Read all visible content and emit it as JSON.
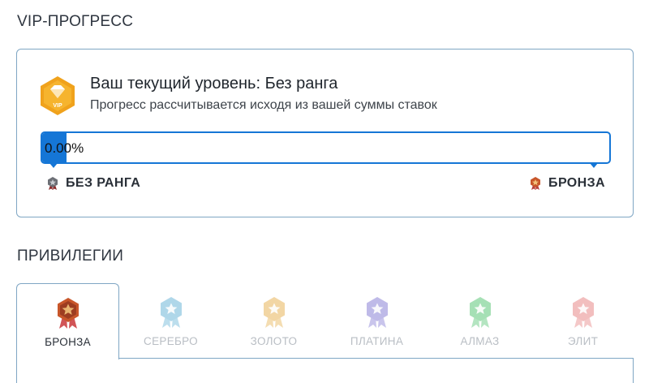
{
  "sections": {
    "vip_title": "VIP-ПРОГРЕСС",
    "privileges_title": "ПРИВИЛЕГИИ"
  },
  "vip": {
    "badge_icon": "vip-diamond-badge-icon",
    "level_title": "Ваш текущий уровень: Без ранга",
    "level_subtitle": "Прогресс рассчитывается исходя из вашей суммы ставок",
    "progress_percent": 0,
    "progress_text": "0.00%",
    "current_rank": "БЕЗ РАНГА",
    "next_rank": "БРОНЗА",
    "accent_color": "#1576d6"
  },
  "privileges": {
    "tabs": [
      {
        "label": "БРОНЗА",
        "active": true,
        "color": "#c8562a"
      },
      {
        "label": "СЕРЕБРО",
        "active": false,
        "color": "#6fb7d8"
      },
      {
        "label": "ЗОЛОТО",
        "active": false,
        "color": "#e8b55a"
      },
      {
        "label": "ПЛАТИНА",
        "active": false,
        "color": "#8b83d6"
      },
      {
        "label": "АЛМАЗ",
        "active": false,
        "color": "#5ec77a"
      },
      {
        "label": "ЭЛИТ",
        "active": false,
        "color": "#e88a8a"
      }
    ]
  }
}
